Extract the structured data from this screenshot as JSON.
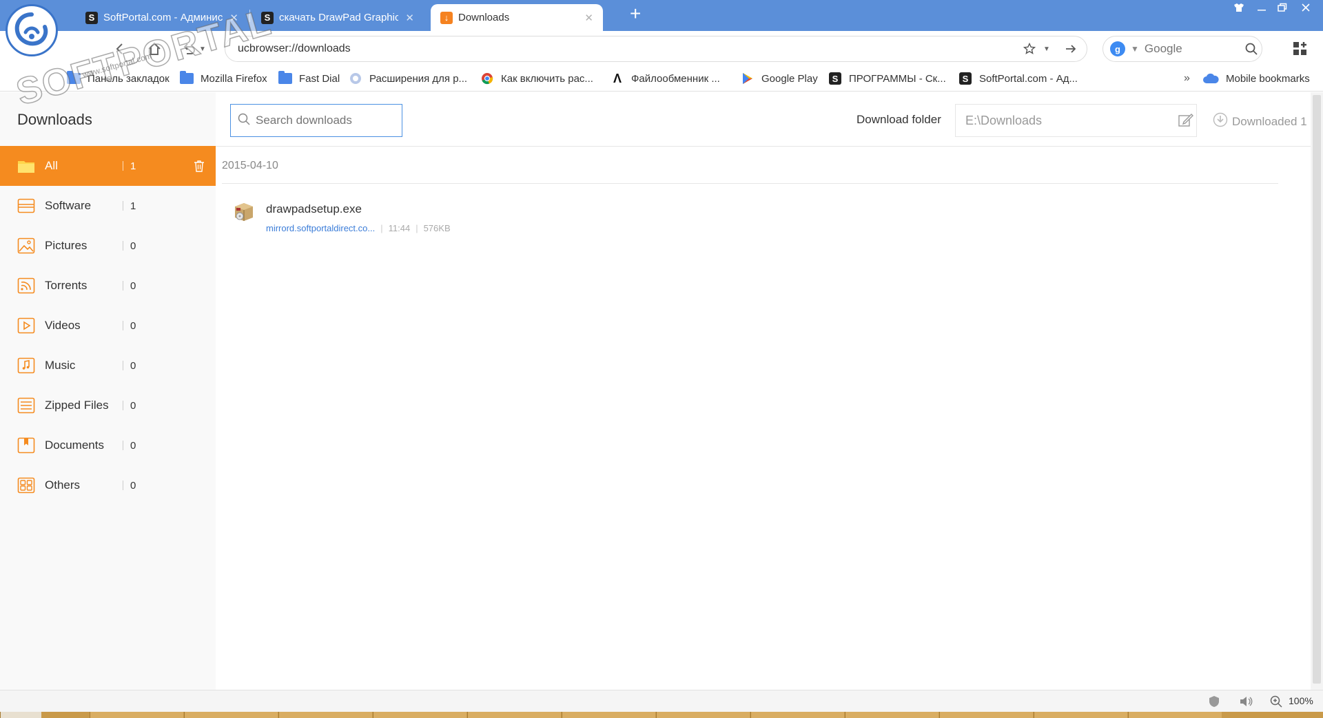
{
  "tabs": [
    {
      "title": "SoftPortal.com - Админис",
      "favicon": "softportal-s-icon",
      "active": false
    },
    {
      "title": "скачать DrawPad Graphic I",
      "favicon": "softportal-s-icon",
      "active": false
    },
    {
      "title": "Downloads",
      "favicon": "download-arrow-icon",
      "active": true
    }
  ],
  "address": {
    "url": "ucbrowser://downloads"
  },
  "search": {
    "engine": "Google",
    "engine_badge": "g"
  },
  "bookmarks": [
    {
      "label": "Панель закладок",
      "icon": "folder-icon"
    },
    {
      "label": "Mozilla Firefox",
      "icon": "folder-icon"
    },
    {
      "label": "Fast Dial",
      "icon": "folder-icon"
    },
    {
      "label": "Расширения для р...",
      "icon": "extension-icon"
    },
    {
      "label": "Как включить рас...",
      "icon": "chrome-icon"
    },
    {
      "label": "Файлообменник ...",
      "icon": "lambda-icon"
    },
    {
      "label": "Google Play",
      "icon": "google-play-icon"
    },
    {
      "label": "ПРОГРАММЫ - Ск...",
      "icon": "softportal-s-icon"
    },
    {
      "label": "SoftPortal.com - Ад...",
      "icon": "softportal-s-icon"
    }
  ],
  "bookmarks_more": "»",
  "mobile_bookmarks": "Mobile bookmarks",
  "sidebar": {
    "title": "Downloads",
    "categories": [
      {
        "label": "All",
        "count": "1",
        "icon": "folder-icon",
        "active": true
      },
      {
        "label": "Software",
        "count": "1",
        "icon": "software-icon"
      },
      {
        "label": "Pictures",
        "count": "0",
        "icon": "picture-icon"
      },
      {
        "label": "Torrents",
        "count": "0",
        "icon": "torrent-icon"
      },
      {
        "label": "Videos",
        "count": "0",
        "icon": "video-icon"
      },
      {
        "label": "Music",
        "count": "0",
        "icon": "music-icon"
      },
      {
        "label": "Zipped Files",
        "count": "0",
        "icon": "zip-icon"
      },
      {
        "label": "Documents",
        "count": "0",
        "icon": "document-icon"
      },
      {
        "label": "Others",
        "count": "0",
        "icon": "others-icon"
      }
    ]
  },
  "main": {
    "search_placeholder": "Search downloads",
    "download_folder_label": "Download folder",
    "download_folder_value": "E:\\Downloads",
    "downloaded_label": "Downloaded 1",
    "groups": [
      {
        "date": "2015-04-10",
        "items": [
          {
            "name": "drawpadsetup.exe",
            "source": "mirrord.softportaldirect.co...",
            "time": "11:44",
            "size": "576KB",
            "icon": "installer-box-icon"
          }
        ]
      }
    ]
  },
  "status": {
    "zoom": "100%"
  },
  "watermark": {
    "text": "SOFTPORTAL",
    "url": "www.softportal.com"
  },
  "colors": {
    "titlebar": "#5b8fd9",
    "accent_orange": "#f58b1f",
    "link_blue": "#3a7cd8",
    "folder_blue": "#4a86e8"
  }
}
